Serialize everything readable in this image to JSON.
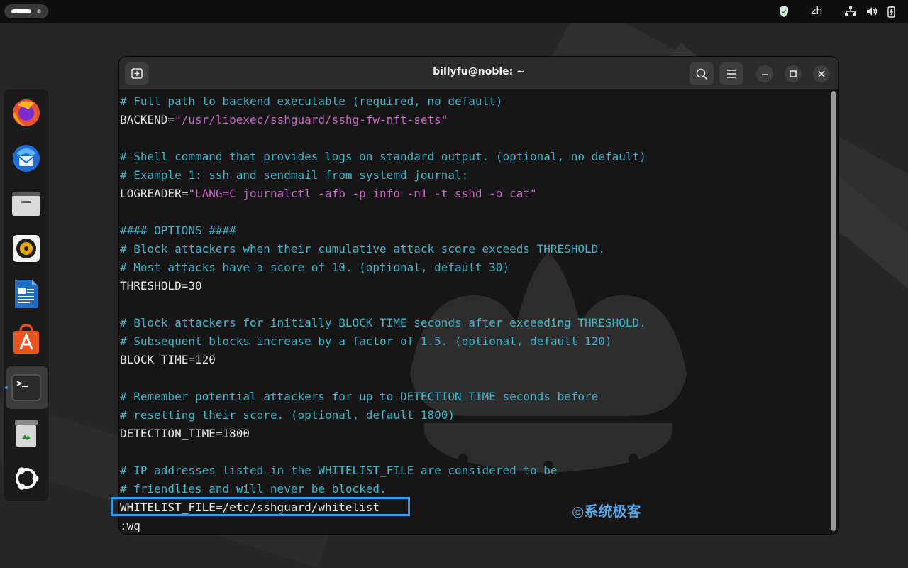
{
  "topbar": {
    "lang": "zh",
    "icons": [
      "shield-icon",
      "network-icon",
      "volume-icon",
      "battery-icon"
    ]
  },
  "dock": {
    "apps": [
      "firefox-icon",
      "thunderbird-icon",
      "files-icon",
      "rhythmbox-icon",
      "writer-icon",
      "app-center-icon",
      "terminal-icon",
      "trash-icon",
      "ubuntu-icon"
    ]
  },
  "window": {
    "title": "billyfu@noble: ~"
  },
  "editor": {
    "lines": [
      {
        "type": "cmt",
        "text": "# Full path to backend executable (required, no default)"
      },
      {
        "type": "kv",
        "key": "BACKEND=",
        "value": "\"/usr/libexec/sshguard/sshg-fw-nft-sets\""
      },
      {
        "type": "blank",
        "text": ""
      },
      {
        "type": "cmt",
        "text": "# Shell command that provides logs on standard output. (optional, no default)"
      },
      {
        "type": "cmt",
        "text": "# Example 1: ssh and sendmail from systemd journal:"
      },
      {
        "type": "kv",
        "key": "LOGREADER=",
        "value": "\"LANG=C journalctl -afb -p info -n1 -t sshd -o cat\""
      },
      {
        "type": "blank",
        "text": ""
      },
      {
        "type": "cmt",
        "text": "#### OPTIONS ####"
      },
      {
        "type": "cmt",
        "text": "# Block attackers when their cumulative attack score exceeds THRESHOLD."
      },
      {
        "type": "cmt",
        "text": "# Most attacks have a score of 10. (optional, default 30)"
      },
      {
        "type": "plain",
        "text": "THRESHOLD=30"
      },
      {
        "type": "blank",
        "text": ""
      },
      {
        "type": "cmt",
        "text": "# Block attackers for initially BLOCK_TIME seconds after exceeding THRESHOLD."
      },
      {
        "type": "cmt",
        "text": "# Subsequent blocks increase by a factor of 1.5. (optional, default 120)"
      },
      {
        "type": "plain",
        "text": "BLOCK_TIME=120"
      },
      {
        "type": "blank",
        "text": ""
      },
      {
        "type": "cmt",
        "text": "# Remember potential attackers for up to DETECTION_TIME seconds before"
      },
      {
        "type": "cmt",
        "text": "# resetting their score. (optional, default 1800)"
      },
      {
        "type": "plain",
        "text": "DETECTION_TIME=1800"
      },
      {
        "type": "blank",
        "text": ""
      },
      {
        "type": "cmt",
        "text": "# IP addresses listed in the WHITELIST_FILE are considered to be"
      },
      {
        "type": "cmt",
        "text": "# friendlies and will never be blocked."
      },
      {
        "type": "plain",
        "text": "WHITELIST_FILE=/etc/sshguard/whitelist"
      },
      {
        "type": "plain",
        "text": ":wq"
      }
    ]
  },
  "watermark": "系统极客",
  "colors": {
    "comment": "#3ab5c8",
    "string": "#c266c2",
    "highlight_border": "#2f9be6"
  }
}
